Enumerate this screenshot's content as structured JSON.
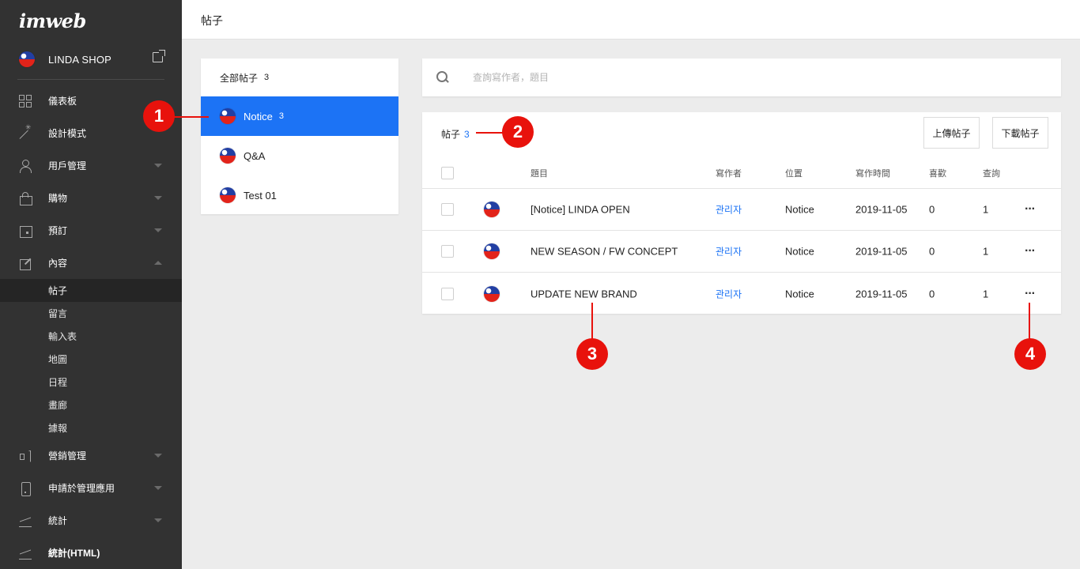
{
  "sidebar": {
    "logo": "imweb",
    "shop_name": "LINDA SHOP",
    "menu": [
      {
        "label": "儀表板",
        "icon": "dashboard-grid-icon",
        "caret": ""
      },
      {
        "label": "設計模式",
        "icon": "magic-wand-icon",
        "caret": ""
      },
      {
        "label": "用戶管理",
        "icon": "user-icon",
        "caret": "down"
      },
      {
        "label": "購物",
        "icon": "shopping-bag-icon",
        "caret": "down"
      },
      {
        "label": "預訂",
        "icon": "calendar-icon",
        "caret": "down"
      },
      {
        "label": "內容",
        "icon": "edit-icon",
        "caret": "up"
      }
    ],
    "submenu": [
      "帖子",
      "留言",
      "輸入表",
      "地圖",
      "日程",
      "畫廊",
      "據報"
    ],
    "submenu_active": 0,
    "menu2": [
      {
        "label": "營銷管理",
        "icon": "megaphone-icon",
        "caret": "down"
      },
      {
        "label": "申請於管理應用",
        "icon": "mobile-icon",
        "caret": "down"
      },
      {
        "label": "統計",
        "icon": "line-chart-icon",
        "caret": "down"
      },
      {
        "label": "統計(HTML)",
        "icon": "line-chart-icon",
        "caret": ""
      }
    ]
  },
  "topbar": {
    "title": "帖子"
  },
  "boards": {
    "all_label": "全部帖子",
    "all_count": "3",
    "items": [
      {
        "name": "Notice",
        "count": "3",
        "selected": true
      },
      {
        "name": "Q&A",
        "count": "",
        "selected": false
      },
      {
        "name": "Test 01",
        "count": "",
        "selected": false
      }
    ]
  },
  "search": {
    "placeholder": "查詢寫作者，題目"
  },
  "posts": {
    "title": "帖子",
    "count": "3",
    "upload_label": "上傳帖子",
    "download_label": "下載帖子",
    "columns": {
      "title": "題目",
      "author": "寫作者",
      "location": "位置",
      "date": "寫作時間",
      "likes": "喜歡",
      "views": "查詢"
    },
    "rows": [
      {
        "title": "[Notice] LINDA OPEN",
        "author": "관리자",
        "location": "Notice",
        "date": "2019-11-05",
        "likes": "0",
        "views": "1",
        "more": "···"
      },
      {
        "title": "NEW SEASON / FW CONCEPT",
        "author": "관리자",
        "location": "Notice",
        "date": "2019-11-05",
        "likes": "0",
        "views": "1",
        "more": "···"
      },
      {
        "title": "UPDATE NEW BRAND",
        "author": "관리자",
        "location": "Notice",
        "date": "2019-11-05",
        "likes": "0",
        "views": "1",
        "more": "···"
      }
    ]
  },
  "callouts": [
    "1",
    "2",
    "3",
    "4"
  ],
  "colors": {
    "accent": "#1c73f5",
    "sidebar": "#323232",
    "callout": "#e8120c"
  }
}
